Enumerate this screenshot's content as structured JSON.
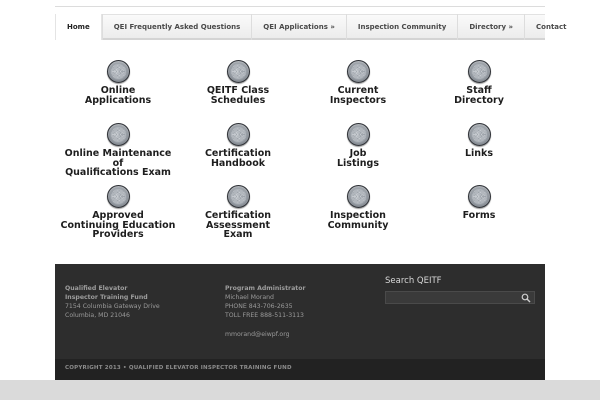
{
  "nav": {
    "items": [
      {
        "label": "Home"
      },
      {
        "label": "QEI Frequently Asked Questions"
      },
      {
        "label": "QEI Applications »"
      },
      {
        "label": "Inspection Community"
      },
      {
        "label": "Directory »"
      },
      {
        "label": "Contact"
      }
    ]
  },
  "tiles": [
    {
      "lines": [
        "Online",
        "Applications"
      ]
    },
    {
      "lines": [
        "QEITF Class",
        "Schedules"
      ]
    },
    {
      "lines": [
        "Current",
        "Inspectors"
      ]
    },
    {
      "lines": [
        "Staff",
        "Directory"
      ]
    },
    {
      "lines": [
        "Online Maintenance of",
        "Qualifications Exam"
      ]
    },
    {
      "lines": [
        "Certification",
        "Handbook"
      ]
    },
    {
      "lines": [
        "Job",
        "Listings"
      ]
    },
    {
      "lines": [
        "Links"
      ]
    },
    {
      "lines": [
        "Approved",
        "Continuing Education",
        "Providers"
      ]
    },
    {
      "lines": [
        "Certification",
        "Assessment",
        "Exam"
      ]
    },
    {
      "lines": [
        "Inspection",
        "Community"
      ]
    },
    {
      "lines": [
        "Forms"
      ]
    }
  ],
  "footer": {
    "org": {
      "line1": "Qualified Elevator",
      "line2": "Inspector Training Fund",
      "address1": "7154 Columbia Gateway Drive",
      "address2": "Columbia, MD 21046"
    },
    "admin": {
      "title": "Program Administrator",
      "name": "Michael Morand",
      "phone": "PHONE 843-706-2635",
      "tollfree": "TOLL FREE 888-511-3113",
      "email": "mmorand@eiwpf.org"
    },
    "search": {
      "title": "Search QEITF",
      "placeholder": ""
    },
    "copyright": "COPYRIGHT 2013 • QUALIFIED ELEVATOR INSPECTOR TRAINING FUND"
  }
}
